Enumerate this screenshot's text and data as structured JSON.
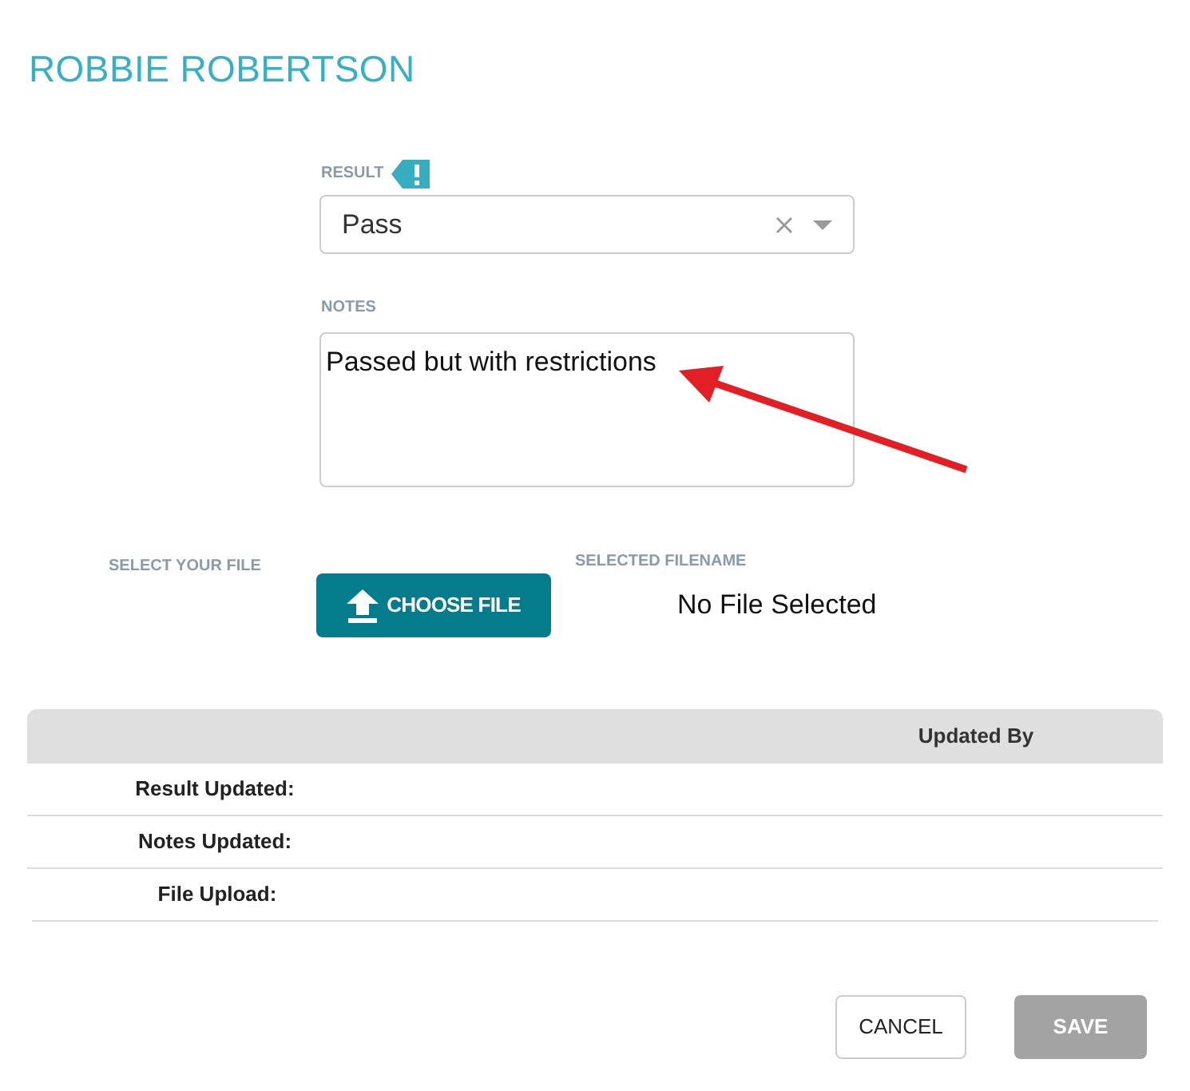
{
  "title": "ROBBIE ROBERTSON",
  "result": {
    "label": "RESULT",
    "value": "Pass"
  },
  "notes": {
    "label": "NOTES",
    "value": "Passed but with restrictions"
  },
  "file": {
    "label": "SELECT YOUR FILE",
    "button": "CHOOSE FILE",
    "filename_label": "SELECTED FILENAME",
    "filename": "No File Selected"
  },
  "table": {
    "header": "Updated By",
    "rows": [
      "Result Updated:",
      "Notes Updated:",
      "File Upload:"
    ]
  },
  "buttons": [
    {
      "label": "CANCEL",
      "disabled": false
    },
    {
      "label": "SAVE",
      "disabled": true
    }
  ]
}
